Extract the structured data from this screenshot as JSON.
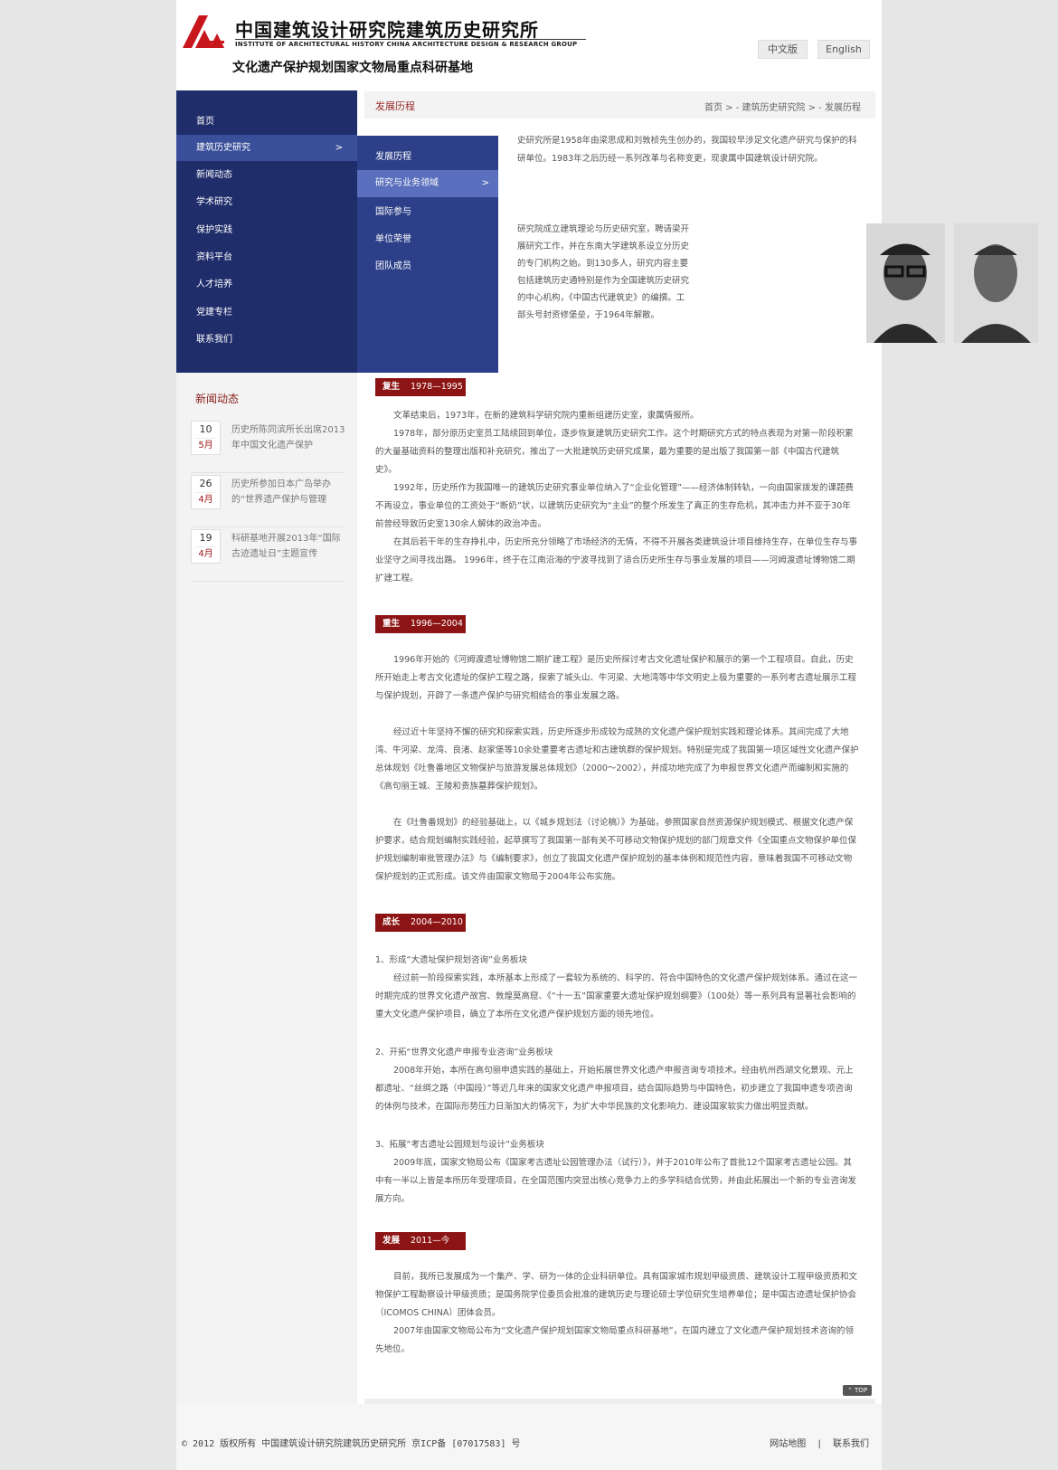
{
  "header": {
    "logo_cn": "中国建筑设计研究院建筑历史研究所",
    "logo_en": "INSTITUTE OF ARCHITECTURAL HISTORY    CHINA ARCHITECTURE DESIGN & RESEARCH GROUP",
    "subtitle": "文化遗产保护规划国家文物局重点科研基地",
    "lang_cn": "中文版",
    "lang_en": "English"
  },
  "nav": {
    "items": [
      {
        "label": "首页"
      },
      {
        "label": "建筑历史研究",
        "arrow": ">"
      },
      {
        "label": "新闻动态"
      },
      {
        "label": "学术研究"
      },
      {
        "label": "保护实践"
      },
      {
        "label": "资料平台"
      },
      {
        "label": "人才培养"
      },
      {
        "label": "党建专栏"
      },
      {
        "label": "联系我们"
      }
    ],
    "submenu": [
      {
        "label": "发展历程"
      },
      {
        "label": "研究与业务领域",
        "arrow": ">"
      },
      {
        "label": "国际参与"
      },
      {
        "label": "单位荣誉"
      },
      {
        "label": "团队成员"
      }
    ]
  },
  "news": {
    "title": "新闻动态",
    "items": [
      {
        "day": "10",
        "month": "5月",
        "text": "历史所陈同滨所长出席2013年中国文化遗产保护"
      },
      {
        "day": "26",
        "month": "4月",
        "text": "历史所参加日本广岛举办的“世界遗产保护与管理"
      },
      {
        "day": "19",
        "month": "4月",
        "text": "科研基地开展2013年“国际古迹遗址日”主题宣传"
      }
    ]
  },
  "breadcrumb": {
    "title": "发展历程",
    "path": "首页 > - 建筑历史研究院 > - 发展历程"
  },
  "content": {
    "intro1": "史研究所是1958年由梁思成和刘敦桢先生创办的，我国较早涉足文化遗产研究与保护的科研单位。1983年之后历经一系列改革与名称变更，现隶属中国建筑设计研究院。",
    "intro2": "研究院成立建筑理论与历史研究室，聘请梁开展研究工作，并在东南大学建筑系设立分历史的专门机构之始。到130多人，研究内容主要包括建筑历史通特别是作为全国建筑历史研究的中心机构，《中国古代建筑史》的编撰。工部头号封资修堡垒，于1964年解散。",
    "eras": [
      {
        "name": "复生",
        "years": "1978—1995"
      },
      {
        "name": "重生",
        "years": "1996—2004"
      },
      {
        "name": "成长",
        "years": "2004—2010"
      },
      {
        "name": "发展",
        "years": "2011—今"
      }
    ],
    "p_fusheng_1": "文革结束后，1973年，在新的建筑科学研究院内重新组建历史室，隶属情报所。",
    "p_fusheng_2": "1978年，部分原历史室员工陆续回到单位，逐步恢复建筑历史研究工作。这个时期研究方式的特点表现为对第一阶段积累的大量基础资料的整理出版和补充研究，推出了一大批建筑历史研究成果，最为重要的是出版了我国第一部《中国古代建筑史》。",
    "p_fusheng_3": "1992年，历史所作为我国唯一的建筑历史研究事业单位纳入了“企业化管理”——经济体制转轨，一向由国家拨发的课题费不再设立，事业单位的工资处于“断奶”状，以建筑历史研究为“主业”的整个所发生了真正的生存危机，其冲击力并不亚于30年前曾经导致历史室130余人解体的政治冲击。",
    "p_fusheng_4": "在其后若干年的生存挣扎中，历史所充分领略了市场经济的无情，不得不开展各类建筑设计项目维持生存，在单位生存与事业坚守之间寻找出路。 1996年，终于在江南沿海的宁波寻找到了适合历史所生存与事业发展的项目——河姆渡遗址博物馆二期扩建工程。",
    "p_chongsheng_1": "1996年开始的《河姆渡遗址博物馆二期扩建工程》是历史所探讨考古文化遗址保护和展示的第一个工程项目。自此，历史所开始走上考古文化遗址的保护工程之路，探索了城头山、牛河梁、大地湾等中华文明史上极为重要的一系列考古遗址展示工程与保护规划，开辟了一条遗产保护与研究相结合的事业发展之路。",
    "p_chongsheng_2": "经过近十年坚持不懈的研究和探索实践，历史所逐步形成较为成熟的文化遗产保护规划实践和理论体系。其间完成了大地湾、牛河梁、龙湾、良渚、赵家堡等10余处重要考古遗址和古建筑群的保护规划。特别是完成了我国第一项区域性文化遗产保护总体规划《吐鲁番地区文物保护与旅游发展总体规划》（2000～2002），并成功地完成了为申报世界文化遗产而编制和实施的《高句丽王城、王陵和贵族墓葬保护规划》。",
    "p_chongsheng_3": "在《吐鲁番规划》的经验基础上，以《城乡规划法（讨论稿）》为基础，参照国家自然资源保护规划模式、根据文化遗产保护要求，结合规划编制实践经验，起草撰写了我国第一部有关不可移动文物保护规划的部门规章文件《全国重点文物保护单位保护规划编制审批管理办法》与《编制要求》，创立了我国文化遗产保护规划的基本体例和规范性内容，意味着我国不可移动文物保护规划的正式形成。该文件由国家文物局于2004年公布实施。",
    "h_chengzhang_1": "1、形成“大遗址保护规划咨询”业务板块",
    "p_chengzhang_1": "经过前一阶段探索实践，本所基本上形成了一套较为系统的、科学的、符合中国特色的文化遗产保护规划体系。通过在这一时期完成的世界文化遗产故宫、敦煌莫高窟、《“十一五”国家重要大遗址保护规划纲要》（100处）等一系列具有显著社会影响的重大文化遗产保护项目，确立了本所在文化遗产保护规划方面的领先地位。",
    "h_chengzhang_2": "2、开拓“世界文化遗产申报专业咨询”业务板块",
    "p_chengzhang_2": "2008年开始，本所在高句丽申遗实践的基础上，开始拓展世界文化遗产申报咨询专项技术。经由杭州西湖文化景观、元上都遗址、“丝绸之路（中国段）”等近几年来的国家文化遗产申报项目，结合国际趋势与中国特色，初步建立了我国申遗专项咨询的体例与技术，在国际形势压力日渐加大的情况下，为扩大中华民族的文化影响力、建设国家软实力做出明显贡献。",
    "h_chengzhang_3": "3、拓展“考古遗址公园规划与设计”业务板块",
    "p_chengzhang_3": "2009年底，国家文物局公布《国家考古遗址公园管理办法（试行）》，并于2010年公布了首批12个国家考古遗址公园。其中有一半以上皆是本所历年受理项目，在全国范围内突显出核心竞争力上的多学科结合优势，并由此拓展出一个新的专业咨询发展方向。",
    "p_fazhan_1": "目前，我所已发展成为一个集产、学、研为一体的企业科研单位。具有国家城市规划甲级资质、建筑设计工程甲级资质和文物保护工程勘察设计甲级资质；是国务院学位委员会批准的建筑历史与理论硕士学位研究生培养单位；是中国古迹遗址保护协会（ICOMOS CHINA）团体会员。",
    "p_fazhan_2": "2007年由国家文物局公布为“文化遗产保护规划国家文物局重点科研基地”，在国内建立了文化遗产保护规划技术咨询的领先地位。"
  },
  "footer": {
    "top": "⌃ TOP",
    "copyright": "© 2012 版权所有 中国建筑设计研究院建筑历史研究所 京ICP备 [07017583] 号",
    "sitemap": "网站地图",
    "sep": "|",
    "contact": "联系我们"
  }
}
